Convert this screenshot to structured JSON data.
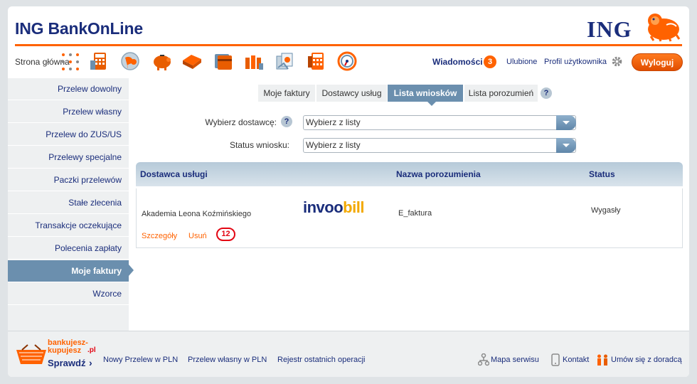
{
  "header": {
    "title": "ING BankOnLine",
    "logo_text": "ING"
  },
  "toolbar": {
    "home_label": "Strona główna",
    "icons": [
      "calculator-icon",
      "globe-icon",
      "piggy-bank-icon",
      "wallet-icon",
      "cards-icon",
      "coins-icon",
      "documents-icon",
      "calculator-orange-icon",
      "gauge-icon"
    ],
    "messages_label": "Wiadomości",
    "messages_count": "3",
    "favorites_label": "Ulubione",
    "profile_label": "Profil użytkownika",
    "logout_label": "Wyloguj"
  },
  "sidebar": {
    "items": [
      {
        "label": "Przelew dowolny"
      },
      {
        "label": "Przelew własny"
      },
      {
        "label": "Przelew do ZUS/US"
      },
      {
        "label": "Przelewy specjalne"
      },
      {
        "label": "Paczki przelewów"
      },
      {
        "label": "Stałe zlecenia"
      },
      {
        "label": "Transakcje oczekujące"
      },
      {
        "label": "Polecenia zapłaty"
      },
      {
        "label": "Moje faktury",
        "active": true
      },
      {
        "label": "Wzorce"
      }
    ]
  },
  "tabs": [
    {
      "label": "Moje faktury"
    },
    {
      "label": "Dostawcy usług"
    },
    {
      "label": "Lista wniosków",
      "active": true
    },
    {
      "label": "Lista porozumień"
    }
  ],
  "filters": {
    "supplier_label": "Wybierz dostawcę:",
    "supplier_value": "Wybierz z listy",
    "status_label": "Status wniosku:",
    "status_value": "Wybierz z listy"
  },
  "table": {
    "columns": [
      "Dostawca usługi",
      "Nazwa porozumienia",
      "Status"
    ],
    "rows": [
      {
        "supplier": "Akademia Leona Koźmińskiego",
        "logo_text_a": "invoo",
        "logo_text_b": "bill",
        "agreement": "E_faktura",
        "status": "Wygasły",
        "details_label": "Szczegóły",
        "delete_label": "Usuń",
        "count": "12"
      }
    ]
  },
  "footer": {
    "promo_line1": "bankujesz-",
    "promo_line2": "kupujesz",
    "promo_suffix": ".pl",
    "promo_cta": "Sprawdź",
    "links": [
      "Nowy Przelew w PLN",
      "Przelew własny w PLN",
      "Rejestr ostatnich operacji"
    ],
    "sitemap_label": "Mapa serwisu",
    "contact_label": "Kontakt",
    "advisor_label": "Umów się z doradcą"
  },
  "colors": {
    "navy": "#1a2d7b",
    "orange": "#ff6200",
    "steel_blue": "#6b8fae"
  }
}
